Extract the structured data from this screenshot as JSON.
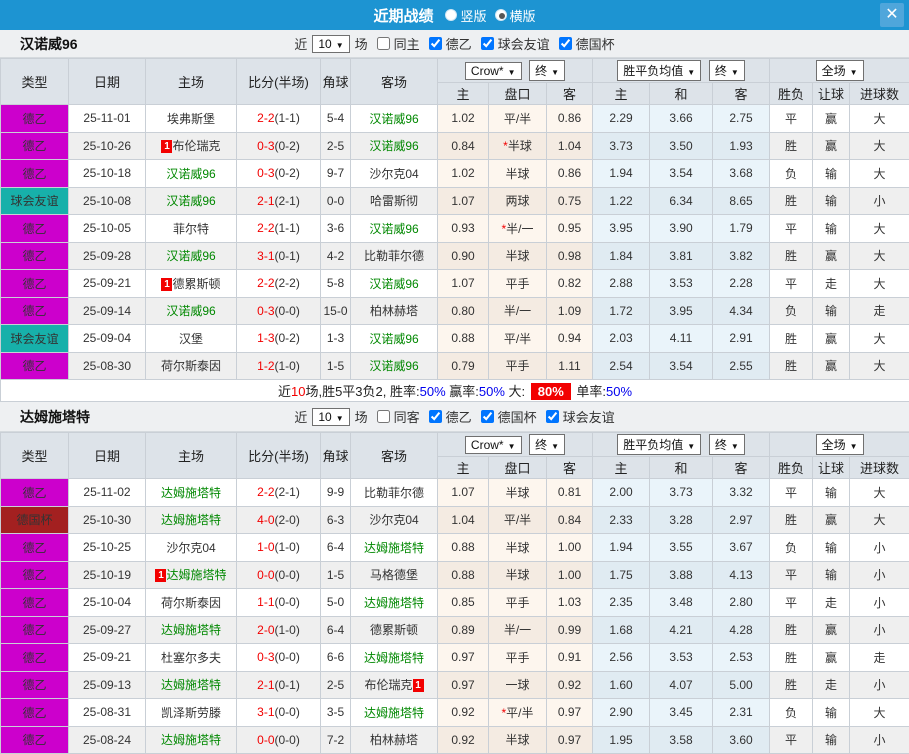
{
  "titlebar": {
    "title": "近期战绩",
    "vertical_label": "竖版",
    "horizontal_label": "横版",
    "close_label": "✕",
    "bar_color": "#1d94d2"
  },
  "table_header": {
    "left": [
      "类型",
      "日期",
      "主场",
      "比分(半场)",
      "角球",
      "客场"
    ],
    "sub": [
      "主",
      "盘口",
      "客",
      "主",
      "和",
      "客",
      "胜负",
      "让球",
      "进球数"
    ],
    "selects": {
      "bookmaker": "Crow*",
      "final1": "终",
      "avg": "胜平负均值",
      "final2": "终",
      "full": "全场"
    },
    "arrow": "▼"
  },
  "colors": {
    "league2": "#cc00cc",
    "friendly": "#17b0aa",
    "cup": "#a32020",
    "focus_team_green": "#008800",
    "score_red": "#f20000"
  },
  "sections": [
    {
      "team": "汉诺威96",
      "controls": {
        "near_label": "近",
        "count": "10",
        "games_label": "场",
        "same_label": "同主",
        "same_checked": false,
        "league_options": [
          {
            "label": "德乙",
            "checked": true
          },
          {
            "label": "球会友谊",
            "checked": true
          },
          {
            "label": "德国杯",
            "checked": true
          }
        ]
      },
      "rows": [
        {
          "type": "德乙",
          "tc": "l2",
          "date": "25-11-01",
          "home": "埃弗斯堡",
          "hg": false,
          "score": "2-2",
          "half": "(1-1)",
          "corner": "5-4",
          "away": "汉诺威96",
          "ag": true,
          "h": "1.02",
          "line": "平/半",
          "a": "0.86",
          "m1": "2.29",
          "m2": "3.66",
          "m3": "2.75",
          "r1": "平",
          "r2": "赢",
          "r3": "大"
        },
        {
          "type": "德乙",
          "tc": "l2",
          "date": "25-10-26",
          "hb": "1",
          "home": "布伦瑞克",
          "hg": false,
          "score": "0-3",
          "half": "(0-2)",
          "corner": "2-5",
          "away": "汉诺威96",
          "ag": true,
          "h": "0.84",
          "star": "*",
          "line": "半球",
          "a": "1.04",
          "m1": "3.73",
          "m2": "3.50",
          "m3": "1.93",
          "r1": "胜",
          "r2": "赢",
          "r3": "大"
        },
        {
          "type": "德乙",
          "tc": "l2",
          "date": "25-10-18",
          "home": "汉诺威96",
          "hg": true,
          "score": "0-3",
          "half": "(0-2)",
          "corner": "9-7",
          "away": "沙尔克04",
          "ag": false,
          "h": "1.02",
          "line": "半球",
          "a": "0.86",
          "m1": "1.94",
          "m2": "3.54",
          "m3": "3.68",
          "r1": "负",
          "r2": "输",
          "r3": "大"
        },
        {
          "type": "球会友谊",
          "tc": "fr",
          "date": "25-10-08",
          "home": "汉诺威96",
          "hg": true,
          "score": "2-1",
          "half": "(2-1)",
          "corner": "0-0",
          "away": "哈雷斯彻",
          "ag": false,
          "h": "1.07",
          "line": "两球",
          "a": "0.75",
          "m1": "1.22",
          "m2": "6.34",
          "m3": "8.65",
          "r1": "胜",
          "r2": "输",
          "r3": "小"
        },
        {
          "type": "德乙",
          "tc": "l2",
          "date": "25-10-05",
          "home": "菲尔特",
          "hg": false,
          "score": "2-2",
          "half": "(1-1)",
          "corner": "3-6",
          "away": "汉诺威96",
          "ag": true,
          "h": "0.93",
          "star": "*",
          "line": "半/一",
          "a": "0.95",
          "m1": "3.95",
          "m2": "3.90",
          "m3": "1.79",
          "r1": "平",
          "r2": "输",
          "r3": "大"
        },
        {
          "type": "德乙",
          "tc": "l2",
          "date": "25-09-28",
          "home": "汉诺威96",
          "hg": true,
          "score": "3-1",
          "half": "(0-1)",
          "corner": "4-2",
          "away": "比勒菲尔德",
          "ag": false,
          "h": "0.90",
          "line": "半球",
          "a": "0.98",
          "m1": "1.84",
          "m2": "3.81",
          "m3": "3.82",
          "r1": "胜",
          "r2": "赢",
          "r3": "大"
        },
        {
          "type": "德乙",
          "tc": "l2",
          "date": "25-09-21",
          "hb": "1",
          "home": "德累斯顿",
          "hg": false,
          "score": "2-2",
          "half": "(2-2)",
          "corner": "5-8",
          "away": "汉诺威96",
          "ag": true,
          "h": "1.07",
          "line": "平手",
          "a": "0.82",
          "m1": "2.88",
          "m2": "3.53",
          "m3": "2.28",
          "r1": "平",
          "r2": "走",
          "r3": "大"
        },
        {
          "type": "德乙",
          "tc": "l2",
          "date": "25-09-14",
          "home": "汉诺威96",
          "hg": true,
          "score": "0-3",
          "half": "(0-0)",
          "corner": "15-0",
          "away": "柏林赫塔",
          "ag": false,
          "h": "0.80",
          "line": "半/一",
          "a": "1.09",
          "m1": "1.72",
          "m2": "3.95",
          "m3": "4.34",
          "r1": "负",
          "r2": "输",
          "r3": "走"
        },
        {
          "type": "球会友谊",
          "tc": "fr",
          "date": "25-09-04",
          "home": "汉堡",
          "hg": false,
          "score": "1-3",
          "half": "(0-2)",
          "corner": "1-3",
          "away": "汉诺威96",
          "ag": true,
          "h": "0.88",
          "line": "平/半",
          "a": "0.94",
          "m1": "2.03",
          "m2": "4.11",
          "m3": "2.91",
          "r1": "胜",
          "r2": "赢",
          "r3": "大"
        },
        {
          "type": "德乙",
          "tc": "l2",
          "date": "25-08-30",
          "home": "荷尔斯泰因",
          "hg": false,
          "score": "1-2",
          "half": "(1-0)",
          "corner": "1-5",
          "away": "汉诺威96",
          "ag": true,
          "h": "0.79",
          "line": "平手",
          "a": "1.11",
          "m1": "2.54",
          "m2": "3.54",
          "m3": "2.55",
          "r1": "胜",
          "r2": "赢",
          "r3": "大"
        }
      ],
      "summary": {
        "near": "近",
        "count": "10",
        "mid": "场,胜5平3负2, 胜率:",
        "win": "50%",
        "profit_label": " 赢率:",
        "profit": "50%",
        "big_label": " 大:",
        "big": "80%",
        "single_label": " 单率:",
        "single": "50%"
      }
    },
    {
      "team": "达姆施塔特",
      "controls": {
        "near_label": "近",
        "count": "10",
        "games_label": "场",
        "same_label": "同客",
        "same_checked": false,
        "league_options": [
          {
            "label": "德乙",
            "checked": true
          },
          {
            "label": "德国杯",
            "checked": true
          },
          {
            "label": "球会友谊",
            "checked": true
          }
        ]
      },
      "rows": [
        {
          "type": "德乙",
          "tc": "l2",
          "date": "25-11-02",
          "home": "达姆施塔特",
          "hg": true,
          "score": "2-2",
          "half": "(2-1)",
          "corner": "9-9",
          "away": "比勒菲尔德",
          "ag": false,
          "h": "1.07",
          "line": "半球",
          "a": "0.81",
          "m1": "2.00",
          "m2": "3.73",
          "m3": "3.32",
          "r1": "平",
          "r2": "输",
          "r3": "大"
        },
        {
          "type": "德国杯",
          "tc": "cup",
          "date": "25-10-30",
          "home": "达姆施塔特",
          "hg": true,
          "score": "4-0",
          "half": "(2-0)",
          "corner": "6-3",
          "away": "沙尔克04",
          "ag": false,
          "h": "1.04",
          "line": "平/半",
          "a": "0.84",
          "m1": "2.33",
          "m2": "3.28",
          "m3": "2.97",
          "r1": "胜",
          "r2": "赢",
          "r3": "大"
        },
        {
          "type": "德乙",
          "tc": "l2",
          "date": "25-10-25",
          "home": "沙尔克04",
          "hg": false,
          "score": "1-0",
          "half": "(1-0)",
          "corner": "6-4",
          "away": "达姆施塔特",
          "ag": true,
          "h": "0.88",
          "line": "半球",
          "a": "1.00",
          "m1": "1.94",
          "m2": "3.55",
          "m3": "3.67",
          "r1": "负",
          "r2": "输",
          "r3": "小"
        },
        {
          "type": "德乙",
          "tc": "l2",
          "date": "25-10-19",
          "hb": "1",
          "home": "达姆施塔特",
          "hg": true,
          "score": "0-0",
          "half": "(0-0)",
          "corner": "1-5",
          "away": "马格德堡",
          "ag": false,
          "h": "0.88",
          "line": "半球",
          "a": "1.00",
          "m1": "1.75",
          "m2": "3.88",
          "m3": "4.13",
          "r1": "平",
          "r2": "输",
          "r3": "小"
        },
        {
          "type": "德乙",
          "tc": "l2",
          "date": "25-10-04",
          "home": "荷尔斯泰因",
          "hg": false,
          "score": "1-1",
          "half": "(0-0)",
          "corner": "5-0",
          "away": "达姆施塔特",
          "ag": true,
          "h": "0.85",
          "line": "平手",
          "a": "1.03",
          "m1": "2.35",
          "m2": "3.48",
          "m3": "2.80",
          "r1": "平",
          "r2": "走",
          "r3": "小"
        },
        {
          "type": "德乙",
          "tc": "l2",
          "date": "25-09-27",
          "home": "达姆施塔特",
          "hg": true,
          "score": "2-0",
          "half": "(1-0)",
          "corner": "6-4",
          "away": "德累斯顿",
          "ag": false,
          "h": "0.89",
          "line": "半/一",
          "a": "0.99",
          "m1": "1.68",
          "m2": "4.21",
          "m3": "4.28",
          "r1": "胜",
          "r2": "赢",
          "r3": "小"
        },
        {
          "type": "德乙",
          "tc": "l2",
          "date": "25-09-21",
          "home": "杜塞尔多夫",
          "hg": false,
          "score": "0-3",
          "half": "(0-0)",
          "corner": "6-6",
          "away": "达姆施塔特",
          "ag": true,
          "h": "0.97",
          "line": "平手",
          "a": "0.91",
          "m1": "2.56",
          "m2": "3.53",
          "m3": "2.53",
          "r1": "胜",
          "r2": "赢",
          "r3": "走"
        },
        {
          "type": "德乙",
          "tc": "l2",
          "date": "25-09-13",
          "home": "达姆施塔特",
          "hg": true,
          "score": "2-1",
          "half": "(0-1)",
          "corner": "2-5",
          "away": "布伦瑞克",
          "ag": false,
          "ab": "1",
          "h": "0.97",
          "line": "一球",
          "a": "0.92",
          "m1": "1.60",
          "m2": "4.07",
          "m3": "5.00",
          "r1": "胜",
          "r2": "走",
          "r3": "小"
        },
        {
          "type": "德乙",
          "tc": "l2",
          "date": "25-08-31",
          "home": "凯泽斯劳滕",
          "hg": false,
          "score": "3-1",
          "half": "(0-0)",
          "corner": "3-5",
          "away": "达姆施塔特",
          "ag": true,
          "h": "0.92",
          "star": "*",
          "line": "平/半",
          "a": "0.97",
          "m1": "2.90",
          "m2": "3.45",
          "m3": "2.31",
          "r1": "负",
          "r2": "输",
          "r3": "大"
        },
        {
          "type": "德乙",
          "tc": "l2",
          "date": "25-08-24",
          "home": "达姆施塔特",
          "hg": true,
          "score": "0-0",
          "half": "(0-0)",
          "corner": "7-2",
          "away": "柏林赫塔",
          "ag": false,
          "h": "0.92",
          "line": "半球",
          "a": "0.97",
          "m1": "1.95",
          "m2": "3.58",
          "m3": "3.60",
          "r1": "平",
          "r2": "输",
          "r3": "小"
        }
      ]
    }
  ]
}
